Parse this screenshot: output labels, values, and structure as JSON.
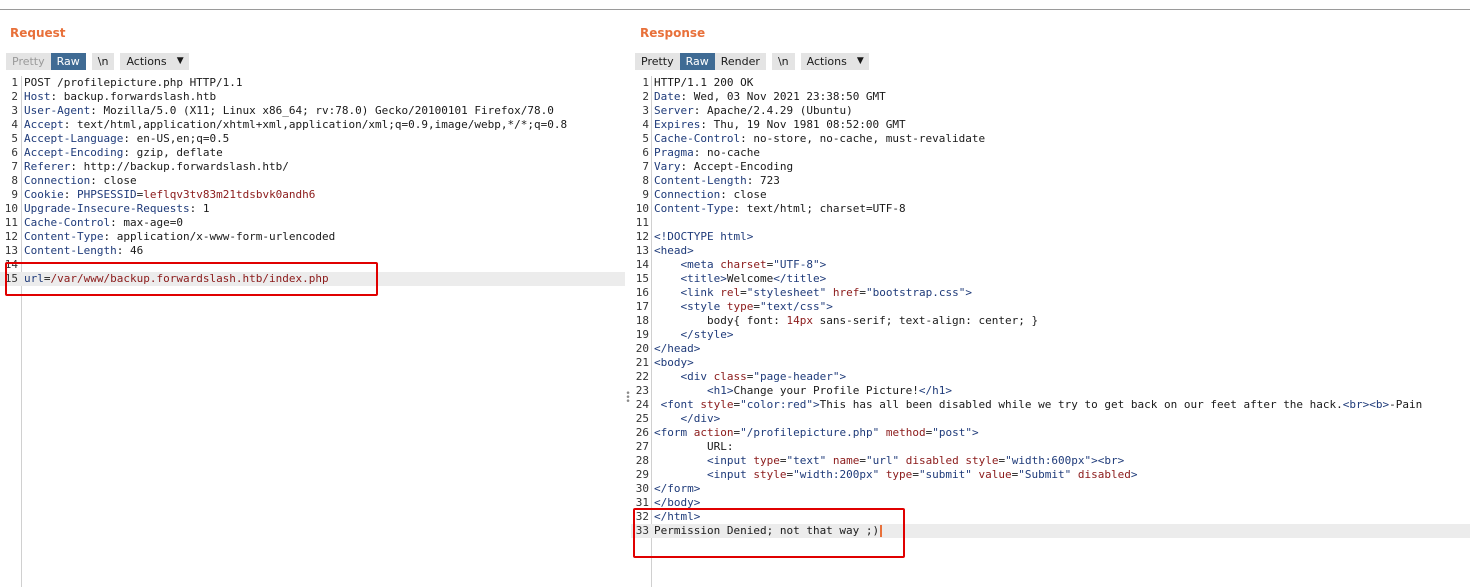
{
  "request": {
    "title": "Request",
    "toolbar": {
      "pretty": "Pretty",
      "raw": "Raw",
      "newline": "\\n",
      "actions": "Actions"
    },
    "lines": [
      {
        "n": "1",
        "text": "POST /profilepicture.php HTTP/1.1"
      },
      {
        "n": "2",
        "key": "Host",
        "sep": ": ",
        "text": "backup.forwardslash.htb"
      },
      {
        "n": "3",
        "key": "User-Agent",
        "sep": ": ",
        "text": "Mozilla/5.0 (X11; Linux x86_64; rv:78.0) Gecko/20100101 Firefox/78.0"
      },
      {
        "n": "4",
        "key": "Accept",
        "sep": ": ",
        "text": "text/html,application/xhtml+xml,application/xml;q=0.9,image/webp,*/*;q=0.8"
      },
      {
        "n": "5",
        "key": "Accept-Language",
        "sep": ": ",
        "text": "en-US,en;q=0.5"
      },
      {
        "n": "6",
        "key": "Accept-Encoding",
        "sep": ": ",
        "text": "gzip, deflate"
      },
      {
        "n": "7",
        "key": "Referer",
        "sep": ": ",
        "text": "http://backup.forwardslash.htb/"
      },
      {
        "n": "8",
        "key": "Connection",
        "sep": ": ",
        "text": "close"
      },
      {
        "n": "9",
        "key": "Cookie",
        "sep": ": ",
        "cookie_name": "PHPSESSID",
        "cookie_eq": "=",
        "cookie_value": "leflqv3tv83m21tdsbvk0andh6"
      },
      {
        "n": "10",
        "key": "Upgrade-Insecure-Requests",
        "sep": ": ",
        "text": "1"
      },
      {
        "n": "11",
        "key": "Cache-Control",
        "sep": ": ",
        "text": "max-age=0"
      },
      {
        "n": "12",
        "key": "Content-Type",
        "sep": ": ",
        "text": "application/x-www-form-urlencoded"
      },
      {
        "n": "13",
        "key": "Content-Length",
        "sep": ": ",
        "text": "46"
      },
      {
        "n": "14",
        "text": ""
      },
      {
        "n": "15",
        "param_name": "url",
        "param_eq": "=",
        "param_value": "/var/www/backup.forwardslash.htb/index.php"
      }
    ]
  },
  "response": {
    "title": "Response",
    "toolbar": {
      "pretty": "Pretty",
      "raw": "Raw",
      "render": "Render",
      "newline": "\\n",
      "actions": "Actions"
    },
    "lines": [
      {
        "n": "1",
        "text": "HTTP/1.1 200 OK"
      },
      {
        "n": "2",
        "key": "Date",
        "sep": ": ",
        "text": "Wed, 03 Nov 2021 23:38:50 GMT"
      },
      {
        "n": "3",
        "key": "Server",
        "sep": ": ",
        "text": "Apache/2.4.29 (Ubuntu)"
      },
      {
        "n": "4",
        "key": "Expires",
        "sep": ": ",
        "text": "Thu, 19 Nov 1981 08:52:00 GMT"
      },
      {
        "n": "5",
        "key": "Cache-Control",
        "sep": ": ",
        "text": "no-store, no-cache, must-revalidate"
      },
      {
        "n": "6",
        "key": "Pragma",
        "sep": ": ",
        "text": "no-cache"
      },
      {
        "n": "7",
        "key": "Vary",
        "sep": ": ",
        "text": "Accept-Encoding"
      },
      {
        "n": "8",
        "key": "Content-Length",
        "sep": ": ",
        "text": "723"
      },
      {
        "n": "9",
        "key": "Connection",
        "sep": ": ",
        "text": "close"
      },
      {
        "n": "10",
        "key": "Content-Type",
        "sep": ": ",
        "text": "text/html; charset=UTF-8"
      },
      {
        "n": "11",
        "segs": []
      },
      {
        "n": "12",
        "segs": [
          [
            "tag",
            "<!DOCTYPE html>"
          ]
        ]
      },
      {
        "n": "13",
        "segs": [
          [
            "tag",
            "<head>"
          ]
        ]
      },
      {
        "n": "14",
        "segs": [
          [
            "plain",
            "    "
          ],
          [
            "tag",
            "<meta "
          ],
          [
            "attr",
            "charset"
          ],
          [
            "plain",
            "="
          ],
          [
            "val",
            "\"UTF-8\""
          ],
          [
            "tag",
            ">"
          ]
        ]
      },
      {
        "n": "15",
        "segs": [
          [
            "plain",
            "    "
          ],
          [
            "tag",
            "<title>"
          ],
          [
            "plain",
            "Welcome"
          ],
          [
            "tag",
            "</title>"
          ]
        ]
      },
      {
        "n": "16",
        "segs": [
          [
            "plain",
            "    "
          ],
          [
            "tag",
            "<link "
          ],
          [
            "attr",
            "rel"
          ],
          [
            "plain",
            "="
          ],
          [
            "val",
            "\"stylesheet\""
          ],
          [
            "plain",
            " "
          ],
          [
            "attr",
            "href"
          ],
          [
            "plain",
            "="
          ],
          [
            "val",
            "\"bootstrap.css\""
          ],
          [
            "tag",
            ">"
          ]
        ]
      },
      {
        "n": "17",
        "segs": [
          [
            "plain",
            "    "
          ],
          [
            "tag",
            "<style "
          ],
          [
            "attr",
            "type"
          ],
          [
            "plain",
            "="
          ],
          [
            "val",
            "\"text/css\""
          ],
          [
            "tag",
            ">"
          ]
        ]
      },
      {
        "n": "18",
        "segs": [
          [
            "plain",
            "        body{ font: "
          ],
          [
            "attr",
            "14px"
          ],
          [
            "plain",
            " sans-serif; text-align: center; }"
          ]
        ]
      },
      {
        "n": "19",
        "segs": [
          [
            "plain",
            "    "
          ],
          [
            "tag",
            "</style>"
          ]
        ]
      },
      {
        "n": "20",
        "segs": [
          [
            "tag",
            "</head>"
          ]
        ]
      },
      {
        "n": "21",
        "segs": [
          [
            "tag",
            "<body>"
          ]
        ]
      },
      {
        "n": "22",
        "segs": [
          [
            "plain",
            "    "
          ],
          [
            "tag",
            "<div "
          ],
          [
            "attr",
            "class"
          ],
          [
            "plain",
            "="
          ],
          [
            "val",
            "\"page-header\""
          ],
          [
            "tag",
            ">"
          ]
        ]
      },
      {
        "n": "23",
        "segs": [
          [
            "plain",
            "        "
          ],
          [
            "tag",
            "<h1>"
          ],
          [
            "plain",
            "Change your Profile Picture!"
          ],
          [
            "tag",
            "</h1>"
          ]
        ]
      },
      {
        "n": "24",
        "segs": [
          [
            "plain",
            " "
          ],
          [
            "tag",
            "<font "
          ],
          [
            "attr",
            "style"
          ],
          [
            "plain",
            "="
          ],
          [
            "val",
            "\"color:red\""
          ],
          [
            "tag",
            ">"
          ],
          [
            "plain",
            "This has all been disabled while we try to get back on our feet after the hack."
          ],
          [
            "tag",
            "<br><b>"
          ],
          [
            "plain",
            "-Pain"
          ]
        ]
      },
      {
        "n": "25",
        "segs": [
          [
            "plain",
            "    "
          ],
          [
            "tag",
            "</div>"
          ]
        ]
      },
      {
        "n": "26",
        "segs": [
          [
            "tag",
            "<form "
          ],
          [
            "attr",
            "action"
          ],
          [
            "plain",
            "="
          ],
          [
            "val",
            "\"/profilepicture.php\""
          ],
          [
            "plain",
            " "
          ],
          [
            "attr",
            "method"
          ],
          [
            "plain",
            "="
          ],
          [
            "val",
            "\"post\""
          ],
          [
            "tag",
            ">"
          ]
        ]
      },
      {
        "n": "27",
        "segs": [
          [
            "plain",
            "        URL:"
          ]
        ]
      },
      {
        "n": "28",
        "segs": [
          [
            "plain",
            "        "
          ],
          [
            "tag",
            "<input "
          ],
          [
            "attr",
            "type"
          ],
          [
            "plain",
            "="
          ],
          [
            "val",
            "\"text\""
          ],
          [
            "plain",
            " "
          ],
          [
            "attr",
            "name"
          ],
          [
            "plain",
            "="
          ],
          [
            "val",
            "\"url\""
          ],
          [
            "plain",
            " "
          ],
          [
            "attr",
            "disabled"
          ],
          [
            "plain",
            " "
          ],
          [
            "attr",
            "style"
          ],
          [
            "plain",
            "="
          ],
          [
            "val",
            "\"width:600px\""
          ],
          [
            "tag",
            "><br>"
          ]
        ]
      },
      {
        "n": "29",
        "segs": [
          [
            "plain",
            "        "
          ],
          [
            "tag",
            "<input "
          ],
          [
            "attr",
            "style"
          ],
          [
            "plain",
            "="
          ],
          [
            "val",
            "\"width:200px\""
          ],
          [
            "plain",
            " "
          ],
          [
            "attr",
            "type"
          ],
          [
            "plain",
            "="
          ],
          [
            "val",
            "\"submit\""
          ],
          [
            "plain",
            " "
          ],
          [
            "attr",
            "value"
          ],
          [
            "plain",
            "="
          ],
          [
            "val",
            "\"Submit\""
          ],
          [
            "plain",
            " "
          ],
          [
            "attr",
            "disabled"
          ],
          [
            "tag",
            ">"
          ]
        ]
      },
      {
        "n": "30",
        "segs": [
          [
            "tag",
            "</form>"
          ]
        ]
      },
      {
        "n": "31",
        "segs": [
          [
            "tag",
            "</body>"
          ]
        ]
      },
      {
        "n": "32",
        "segs": [
          [
            "tag",
            "</html>"
          ]
        ]
      },
      {
        "n": "33",
        "segs": [
          [
            "plain",
            "Permission Denied; not that way ;)"
          ]
        ]
      }
    ]
  },
  "colors": {
    "title": "#e8703a",
    "active_button": "#3f6b94",
    "highlight_box": "#e00000",
    "header_key": "#1f3b7a",
    "attribute": "#8b1a1a"
  }
}
